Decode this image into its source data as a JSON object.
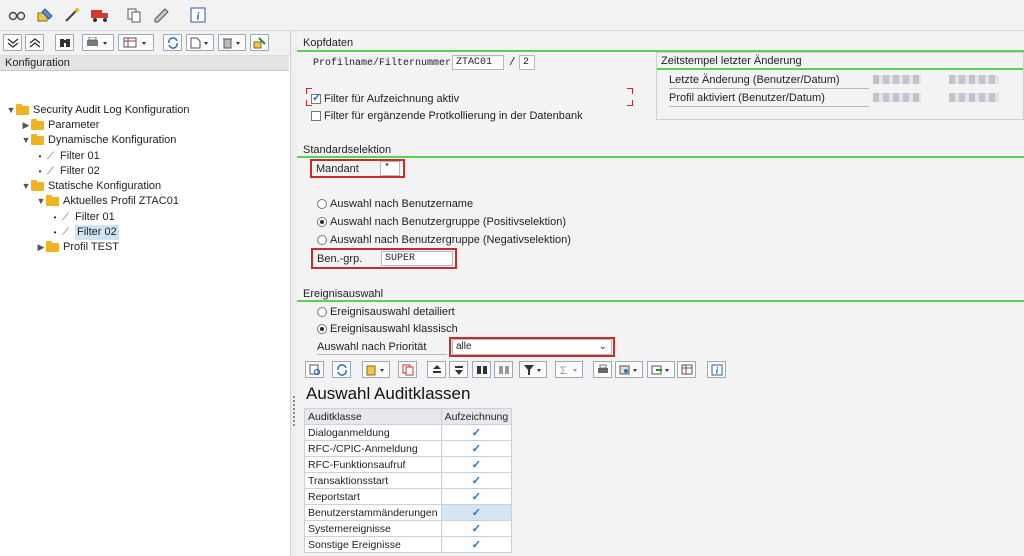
{
  "toolbar": {
    "icons": [
      "glasses-icon",
      "edit-icon",
      "wand-icon",
      "truck-icon",
      "copy-icon",
      "pen-icon",
      "info-icon"
    ]
  },
  "left": {
    "tree_header": "Konfiguration",
    "tree": [
      {
        "label": "Security Audit Log Konfiguration",
        "type": "folder",
        "level": 0,
        "expanded": true
      },
      {
        "label": "Parameter",
        "type": "folder",
        "level": 1,
        "expanded": false
      },
      {
        "label": "Dynamische Konfiguration",
        "type": "folder",
        "level": 1,
        "expanded": true
      },
      {
        "label": "Filter 01",
        "type": "filter",
        "level": 2
      },
      {
        "label": "Filter 02",
        "type": "filter",
        "level": 2
      },
      {
        "label": "Statische Konfiguration",
        "type": "folder",
        "level": 1,
        "expanded": true
      },
      {
        "label": "Aktuelles Profil ZTAC01",
        "type": "folder",
        "level": 2,
        "expanded": true
      },
      {
        "label": "Filter 01",
        "type": "filter",
        "level": 3
      },
      {
        "label": "Filter 02",
        "type": "filter",
        "level": 3,
        "selected": true
      },
      {
        "label": "Profil TEST",
        "type": "folder",
        "level": 2,
        "expanded": false
      }
    ]
  },
  "kopfdaten": {
    "title": "Kopfdaten",
    "profile_label": "Profilname/Filternummer",
    "profile_value": "ZTAC01",
    "separator": "/",
    "filter_value": "2",
    "chk_filter_active": "Filter für Aufzeichnung aktiv",
    "chk_extended": "Filter für ergänzende Protkollierung in der Datenbank",
    "timestamp_title": "Zeitstempel letzter Änderung",
    "last_change": "Letzte Änderung (Benutzer/Datum)",
    "profile_activated": "Profil aktiviert (Benutzer/Datum)"
  },
  "standardselektion": {
    "title": "Standardselektion",
    "mandant_label": "Mandant",
    "mandant_value": "*",
    "radio1": "Auswahl nach Benutzername",
    "radio2": "Auswahl nach Benutzergruppe (Positivselektion)",
    "radio3": "Auswahl nach Benutzergruppe (Negativselektion)",
    "bengrp_label": "Ben.-grp.",
    "bengrp_value": "SUPER"
  },
  "ereignisauswahl": {
    "title": "Ereignisauswahl",
    "radio_detail": "Ereignisauswahl detailiert",
    "radio_classic": "Ereignisauswahl klassisch",
    "priority_label": "Auswahl nach Priorität",
    "priority_value": "alle"
  },
  "alv": {
    "title": "Auswahl Auditklassen",
    "col1": "Auditklasse",
    "col2": "Aufzeichnung",
    "rows": [
      "Dialoganmeldung",
      "RFC-/CPIC-Anmeldung",
      "RFC-Funktionsaufruf",
      "Transaktionsstart",
      "Reportstart",
      "Benutzerstammänderungen",
      "Systemereignisse",
      "Sonstige Ereignisse"
    ]
  }
}
